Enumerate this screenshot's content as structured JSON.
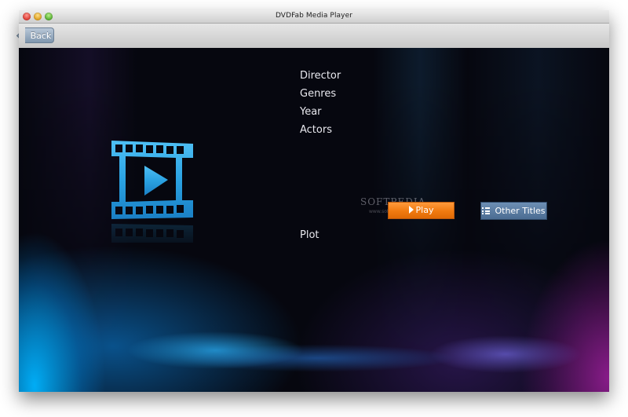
{
  "window": {
    "title": "DVDFab Media Player",
    "traffic_lights": [
      "close",
      "minimize",
      "zoom"
    ]
  },
  "toolbar": {
    "back_label": "Back"
  },
  "movie_info": {
    "fields": [
      {
        "label": "Director"
      },
      {
        "label": "Genres"
      },
      {
        "label": "Year"
      },
      {
        "label": "Actors"
      }
    ],
    "plot_label": "Plot",
    "poster_icon": "film-strip-play-icon"
  },
  "actions": {
    "play_label": "Play",
    "play_icon": "play-triangle-icon",
    "other_titles_label": "Other Titles",
    "other_titles_icon": "list-icon"
  },
  "watermark": {
    "text": "SOFTPEDIA",
    "sub": "www.softpedia.com"
  },
  "colors": {
    "play_button": "#f07a10",
    "other_titles_button": "#4b6c92",
    "film_icon": "#29a3e0",
    "background": "#06070f"
  }
}
